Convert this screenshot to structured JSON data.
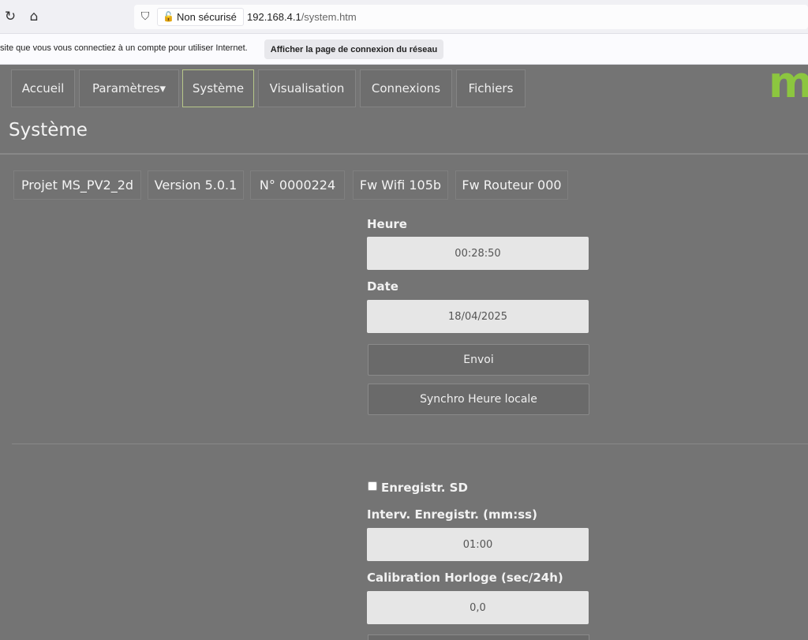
{
  "browser": {
    "reload_icon": "reload-icon",
    "home_icon": "home-icon",
    "security_label": "Non sécurisé",
    "url_host": "192.168.4.1",
    "url_path": "/system.htm",
    "notification_text": "site que vous vous connectiez à un compte pour utiliser Internet.",
    "notification_button": "Afficher la page de connexion du réseau"
  },
  "nav": {
    "items": [
      {
        "label": "Accueil"
      },
      {
        "label": "Paramètres▾"
      },
      {
        "label": "Système"
      },
      {
        "label": "Visualisation"
      },
      {
        "label": "Connexions"
      },
      {
        "label": "Fichiers"
      }
    ],
    "logo_text": "m",
    "active_index": 2
  },
  "page": {
    "title": "Système"
  },
  "info": [
    "Projet MS_PV2_2d",
    "Version 5.0.1",
    "N° 0000224",
    "Fw Wifi 105b",
    "Fw Routeur 000"
  ],
  "time_section": {
    "heure_label": "Heure",
    "heure_value": "00:28:50",
    "date_label": "Date",
    "date_value": "18/04/2025",
    "envoi_button": "Envoi",
    "synchro_button": "Synchro Heure locale"
  },
  "sd_section": {
    "enregistr_label": "Enregistr. SD",
    "enregistr_checked": false,
    "interv_label": "Interv. Enregistr. (mm:ss)",
    "interv_value": "01:00",
    "calibration_label": "Calibration Horloge (sec/24h)",
    "calibration_value": "0,0"
  }
}
